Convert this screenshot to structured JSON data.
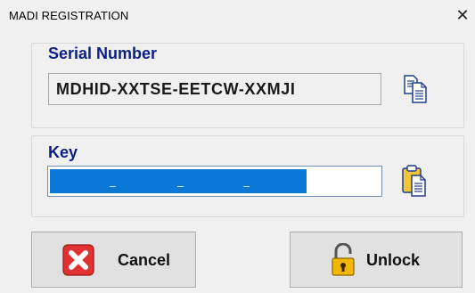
{
  "window": {
    "title": "MADI REGISTRATION",
    "close_glyph": "✕"
  },
  "serial": {
    "label": "Serial Number",
    "value": "MDHID-XXTSE-EETCW-XXMJI",
    "copy_icon": "copy-icon"
  },
  "key": {
    "label": "Key",
    "value": "",
    "paste_icon": "paste-icon",
    "selection_color": "#0b78d8"
  },
  "buttons": {
    "cancel": {
      "label": "Cancel",
      "icon": "cancel-x-icon",
      "icon_color": "#e03030"
    },
    "unlock": {
      "label": "Unlock",
      "icon": "padlock-open-icon",
      "icon_color": "#f2b705"
    }
  },
  "colors": {
    "label_blue": "#0a1f84",
    "window_bg": "#f0f0f0"
  }
}
